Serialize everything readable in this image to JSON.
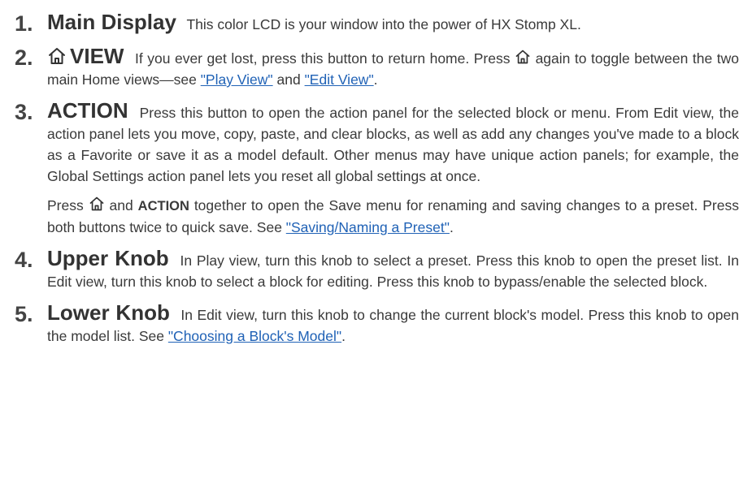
{
  "items": [
    {
      "number": "1.",
      "title": "Main Display",
      "text": "This color LCD is your window into the power of HX Stomp XL."
    },
    {
      "number": "2.",
      "title": "VIEW",
      "text_a": "If you ever get lost, press this button to return home. Press",
      "text_b": "again to toggle between the two main Home views—see",
      "link_1": "\"Play View\"",
      "and": "and",
      "link_2": "\"Edit View\"",
      "end": "."
    },
    {
      "number": "3.",
      "title": "ACTION",
      "text": "Press this button to open the action panel for the selected block or menu. From Edit view, the action panel lets you move, copy, paste, and clear blocks, as well as add any changes you've made to a block as a Favorite or save it as a model default. Other menus may have unique action panels; for example, the Global Settings action panel lets you reset all global settings at once.",
      "p2_a": "Press",
      "p2_and": "and",
      "p2_bold": "ACTION",
      "p2_b": "together to open the Save menu for renaming and saving changes to a preset. Press both buttons twice to quick save. See",
      "p2_link": "\"Saving/Naming a Preset\"",
      "p2_end": "."
    },
    {
      "number": "4.",
      "title": "Upper Knob",
      "text": "In Play view, turn this knob to select a preset. Press this knob to open the preset list. In Edit view, turn this knob to select a block for editing. Press this knob to bypass/enable the selected block."
    },
    {
      "number": "5.",
      "title": "Lower Knob",
      "text": "In Edit view, turn this knob to change the current block's model. Press this knob to open the model list. See",
      "link": "\"Choosing a Block's Model\"",
      "end": "."
    }
  ],
  "icons": {
    "home": "home-icon"
  },
  "colors": {
    "text": "#3a3a3a",
    "link": "#2062b6"
  }
}
